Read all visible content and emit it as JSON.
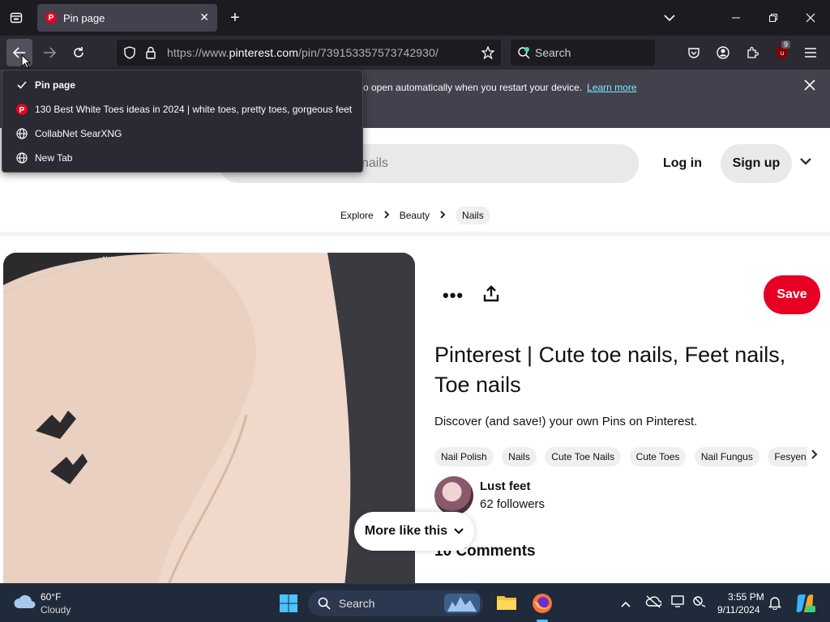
{
  "browser": {
    "tab_title": "Pin page",
    "tab_favicon": "P",
    "url_prefix": "https://www.",
    "url_host": "pinterest.com",
    "url_path": "/pin/739153357573742930/",
    "search_placeholder": "Search",
    "addons_badge": "9"
  },
  "notification": {
    "message": "o open automatically when you restart your device.",
    "link": "Learn more"
  },
  "history": {
    "items": [
      {
        "label": "Pin page",
        "current": true
      },
      {
        "label": "130 Best White Toes ideas in 2024 | white toes, pretty toes, gorgeous feet",
        "current": false
      },
      {
        "label": "CollabNet SearXNG",
        "current": false
      },
      {
        "label": "New Tab",
        "current": false
      }
    ]
  },
  "pinterest": {
    "search_partial": "nails",
    "login": "Log in",
    "signup": "Sign up",
    "breadcrumbs": [
      "Explore",
      "Beauty",
      "Nails"
    ],
    "save": "Save",
    "title": "Pinterest | Cute toe nails, Feet nails, Toe nails",
    "description": "Discover (and save!) your own Pins on Pinterest.",
    "tags": [
      "Nail Polish",
      "Nails",
      "Cute Toe Nails",
      "Cute Toes",
      "Nail Fungus",
      "Fesyen Wanita"
    ],
    "author": "Lust feet",
    "followers": "62 followers",
    "more_like_this": "More like this",
    "comments": "10 Comments",
    "accent_color": "#e60023"
  },
  "taskbar": {
    "temp": "60°F",
    "weather": "Cloudy",
    "search": "Search",
    "time": "3:55 PM",
    "date": "9/11/2024"
  }
}
